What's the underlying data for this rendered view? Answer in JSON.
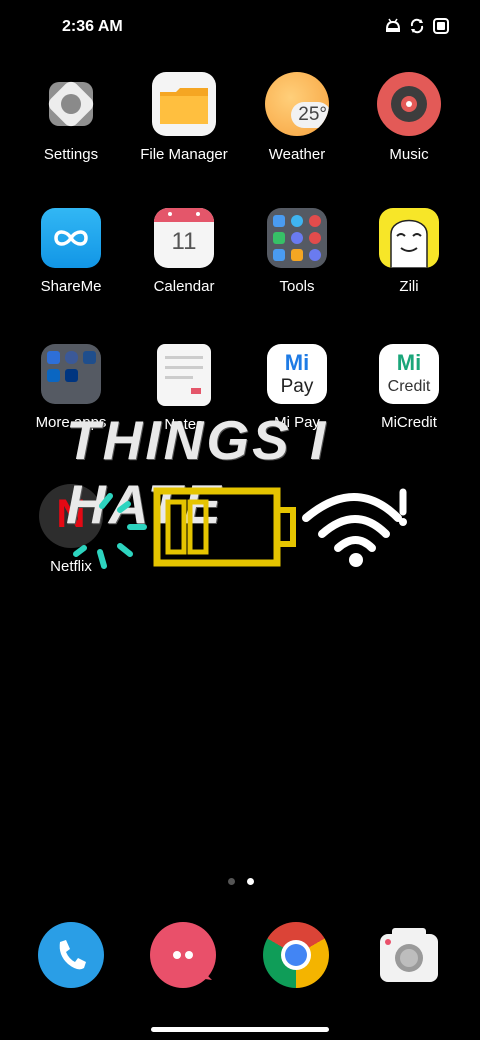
{
  "status_bar": {
    "time": "2:36 AM",
    "icons": [
      "android-debug-icon",
      "sync-icon",
      "screen-record-icon"
    ]
  },
  "apps": [
    {
      "label": "Settings",
      "icon": "settings-icon"
    },
    {
      "label": "File Manager",
      "icon": "folder-icon"
    },
    {
      "label": "Weather",
      "icon": "weather-icon",
      "temp": "25°"
    },
    {
      "label": "Music",
      "icon": "music-icon"
    },
    {
      "label": "ShareMe",
      "icon": "shareme-icon"
    },
    {
      "label": "Calendar",
      "icon": "calendar-icon",
      "day": "11"
    },
    {
      "label": "Tools",
      "icon": "tools-folder-icon"
    },
    {
      "label": "Zili",
      "icon": "zili-icon"
    },
    {
      "label": "More apps",
      "icon": "more-apps-folder-icon"
    },
    {
      "label": "Notes",
      "icon": "notes-icon"
    },
    {
      "label": "Mi Pay",
      "icon": "mi-pay-icon",
      "brand": "Mi",
      "sub": "Pay"
    },
    {
      "label": "MiCredit",
      "icon": "mi-credit-icon",
      "brand": "Mi",
      "sub": "Credit"
    },
    {
      "label": "Netflix",
      "icon": "netflix-icon",
      "letter": "N"
    }
  ],
  "overlay": {
    "title": "THINGS I HATE",
    "stickers": [
      "low-battery-icon",
      "weak-wifi-icon"
    ],
    "colors": {
      "battery": "#e5c400",
      "sparks": "#2dd4bf",
      "wifi": "#ffffff"
    }
  },
  "page_indicator": {
    "count": 2,
    "active": 1
  },
  "dock": [
    {
      "icon": "phone-icon"
    },
    {
      "icon": "messaging-icon"
    },
    {
      "icon": "chrome-icon"
    },
    {
      "icon": "camera-icon"
    }
  ]
}
